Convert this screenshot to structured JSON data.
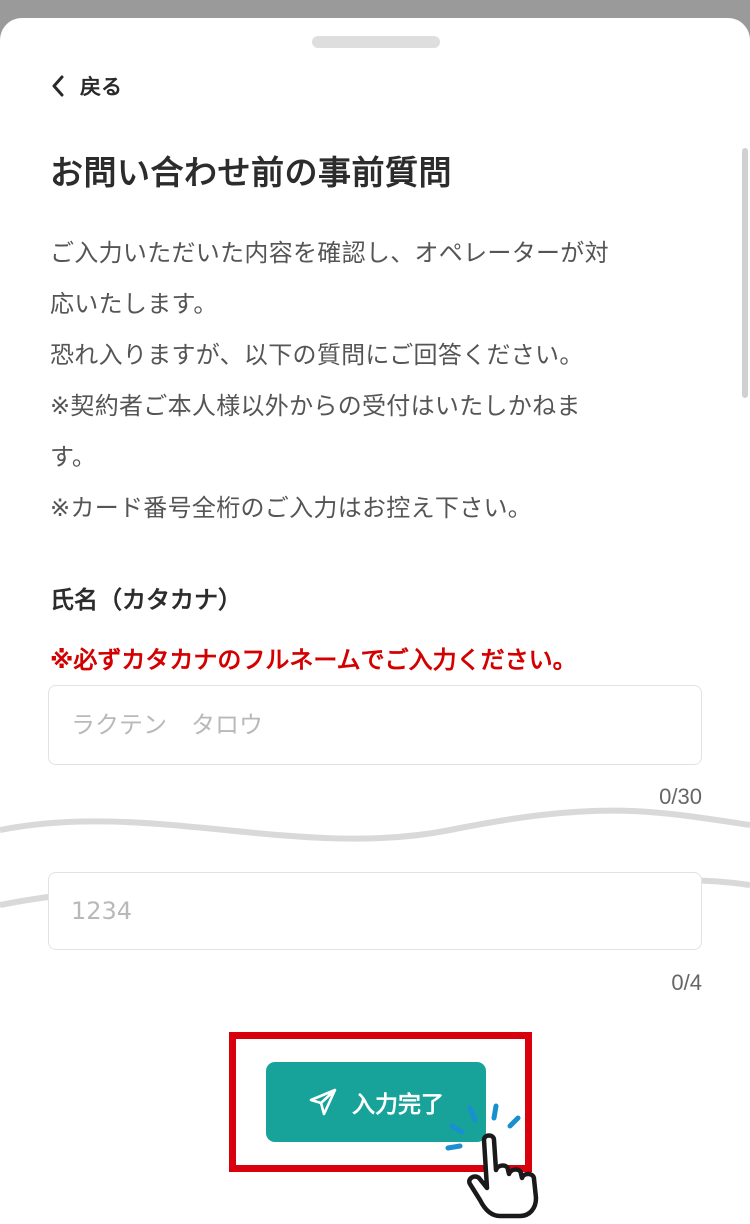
{
  "nav": {
    "back_label": "戻る"
  },
  "page": {
    "title": "お問い合わせ前の事前質問"
  },
  "description": {
    "lines": [
      "ご入力いただいた内容を確認し、オペレーターが対",
      "応いたします。",
      "恐れ入りますが、以下の質問にご回答ください。",
      "※契約者ご本人様以外からの受付はいたしかねま",
      "す。",
      "※カード番号全桁のご入力はお控え下さい。"
    ]
  },
  "form": {
    "name_field": {
      "label": "氏名（カタカナ）",
      "notice": "※必ずカタカナのフルネームでご入力ください。",
      "placeholder": "ラクテン　タロウ",
      "counter": "0/30"
    },
    "number_field": {
      "placeholder": "1234",
      "counter": "0/4"
    },
    "submit_label": "入力完了"
  },
  "colors": {
    "accent": "#17a29a",
    "notice": "#d40000",
    "highlight": "#d9000d"
  },
  "icons": {
    "back": "chevron-left-icon",
    "submit": "send-icon",
    "pointer": "pointing-hand-icon"
  }
}
